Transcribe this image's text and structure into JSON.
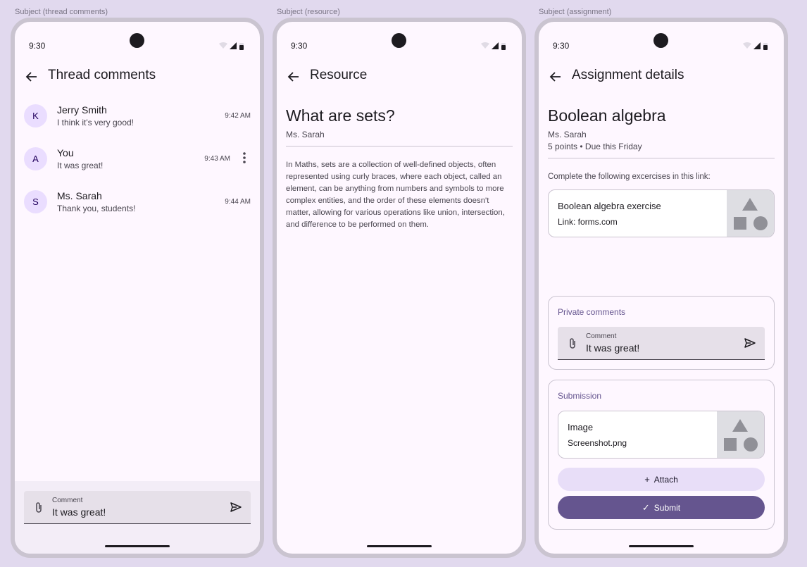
{
  "captions": [
    "Subject (thread comments)",
    "Subject (resource)",
    "Subject (assignment)"
  ],
  "status": {
    "time": "9:30"
  },
  "thread": {
    "title": "Thread comments",
    "comments": [
      {
        "initial": "K",
        "name": "Jerry Smith",
        "text": "I think it's very good!",
        "time": "9:42 AM"
      },
      {
        "initial": "A",
        "name": "You",
        "text": "It was great!",
        "time": "9:43 AM"
      },
      {
        "initial": "S",
        "name": "Ms. Sarah",
        "text": "Thank you, students!",
        "time": "9:44 AM"
      }
    ],
    "input": {
      "label": "Comment",
      "value": "It was great!"
    }
  },
  "resource": {
    "title": "Resource",
    "heading": "What are sets?",
    "author": "Ms. Sarah",
    "body": "In Maths, sets are a collection of well-defined objects, often represented using curly braces, where each object, called an element, can be anything from numbers and symbols to more complex entities, and the order of these elements doesn't matter, allowing for various operations like union, intersection, and difference to be performed on them."
  },
  "assignment": {
    "title": "Assignment details",
    "heading": "Boolean algebra",
    "author": "Ms. Sarah",
    "points": "5 points • Due this Friday",
    "instructions": "Complete the following excercises in this link:",
    "link_card": {
      "title": "Boolean algebra exercise",
      "subtitle": "Link: forms.com"
    },
    "private_comments": {
      "title": "Private comments",
      "label": "Comment",
      "value": "It was great!"
    },
    "submission": {
      "title": "Submission",
      "file": {
        "title": "Image",
        "subtitle": "Screenshot.png"
      },
      "attach_label": "Attach",
      "submit_label": "Submit"
    }
  }
}
